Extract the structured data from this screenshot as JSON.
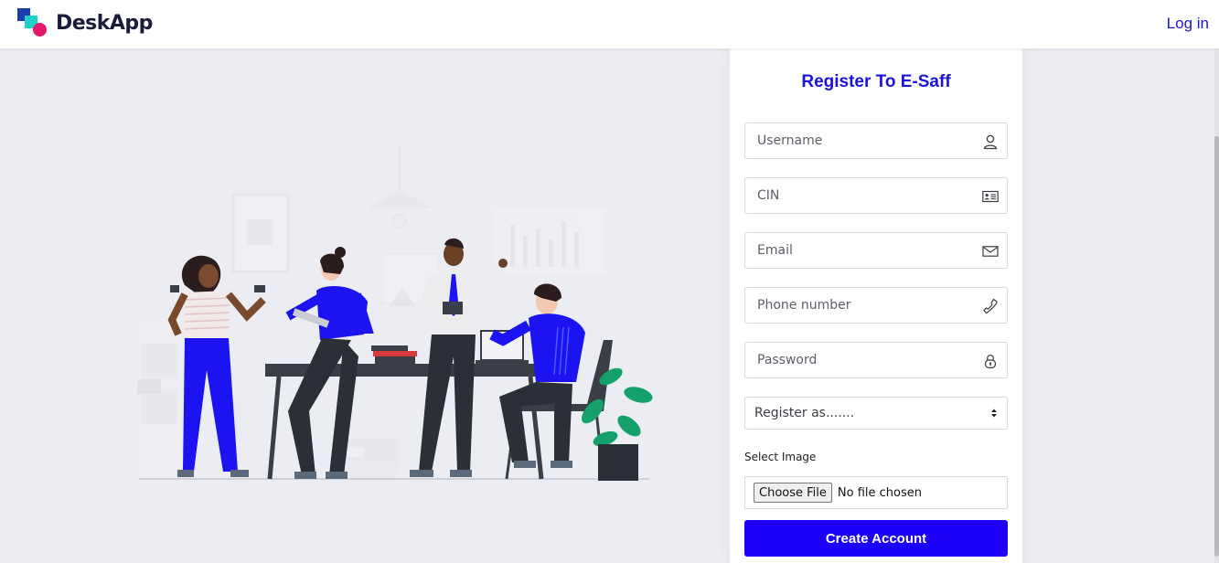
{
  "header": {
    "brand_name": "DeskApp",
    "login_label": "Log in"
  },
  "form": {
    "title": "Register To E-Saff",
    "username_placeholder": "Username",
    "cin_placeholder": "CIN",
    "email_placeholder": "Email",
    "phone_placeholder": "Phone number",
    "password_placeholder": "Password",
    "role_select_value": "Register as.......",
    "image_label": "Select Image",
    "file_button_label": "Choose File",
    "file_status": "No file chosen",
    "submit_label": "Create Account"
  },
  "icons": {
    "username": "user-icon",
    "cin": "id-card-icon",
    "email": "envelope-icon",
    "phone": "phone-icon",
    "password": "lock-icon"
  },
  "colors": {
    "accent": "#1b14d8",
    "button": "#1b00f5",
    "figure_blue": "#1b14f0",
    "background": "#ecedf2"
  }
}
